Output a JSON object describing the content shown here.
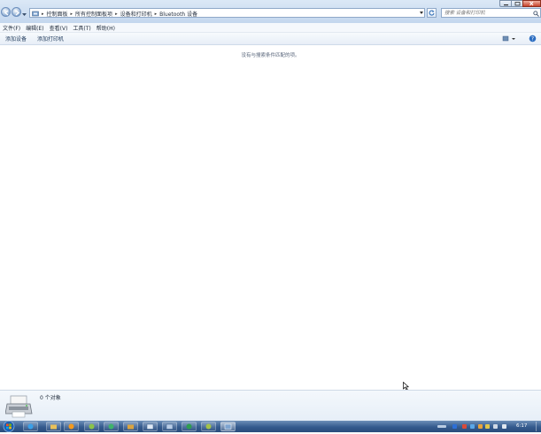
{
  "address": {
    "crumbs": [
      "控制面板",
      "所有控制面板项",
      "设备和打印机",
      "Bluetooth 设备"
    ]
  },
  "search": {
    "placeholder": "搜索 设备和打印机"
  },
  "menu": {
    "items": [
      "文件(F)",
      "编辑(E)",
      "查看(V)",
      "工具(T)",
      "帮助(H)"
    ]
  },
  "commands": {
    "add_device": "添加设备",
    "add_printer": "添加打印机"
  },
  "content": {
    "empty_message": "没有与搜索条件匹配的项。"
  },
  "details": {
    "count_text": "0 个对象"
  },
  "taskbar": {
    "clock": "6:17"
  },
  "colors": {
    "titlebar": "#c4d7ee",
    "taskbar": "#345a8d",
    "accent": "#1e395b"
  },
  "icons": [
    "back-arrow-icon",
    "forward-arrow-icon",
    "control-panel-icon",
    "dropdown-icon",
    "refresh-icon",
    "search-icon",
    "view-options-icon",
    "help-icon",
    "printer-device-icon",
    "start-orb-icon"
  ]
}
